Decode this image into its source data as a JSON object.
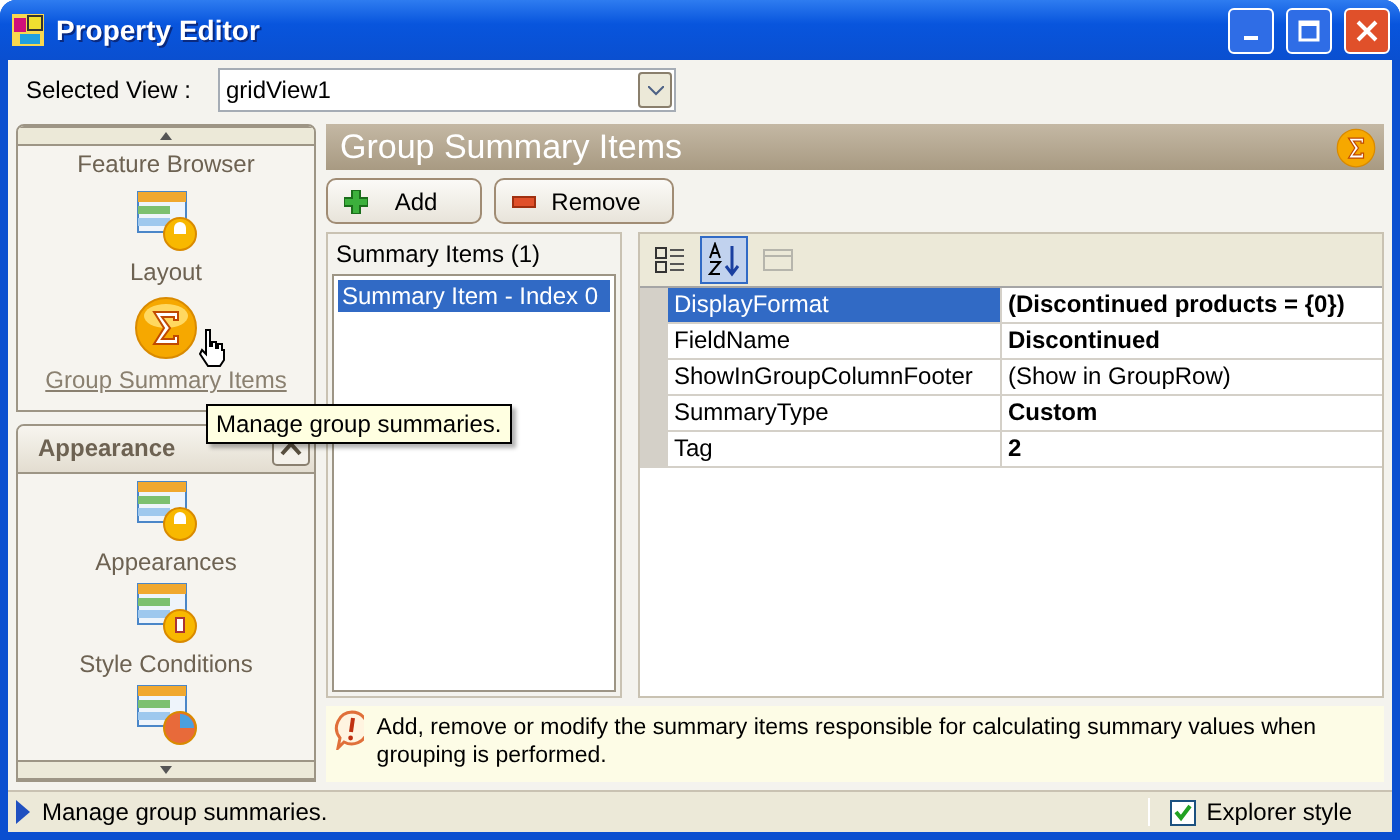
{
  "window": {
    "title": "Property Editor"
  },
  "selected_view": {
    "label": "Selected View :",
    "value": "gridView1"
  },
  "nav_groups": [
    {
      "items": [
        {
          "label": "Feature Browser",
          "kind": "text",
          "hovered": false
        },
        {
          "label": "Layout",
          "kind": "grid",
          "hovered": false
        },
        {
          "label": "Group Summary Items",
          "kind": "sigma",
          "hovered": true
        }
      ]
    },
    {
      "title": "Appearance",
      "expanded": true,
      "items": [
        {
          "label": "Appearances",
          "kind": "grid",
          "hovered": false
        },
        {
          "label": "Style Conditions",
          "kind": "brush",
          "hovered": false
        },
        {
          "kind": "pie"
        }
      ]
    }
  ],
  "tooltip": "Manage group summaries.",
  "panel": {
    "title": "Group Summary Items",
    "buttons": [
      {
        "label": "Add",
        "kind": "add"
      },
      {
        "label": "Remove",
        "kind": "remove"
      }
    ],
    "list": {
      "header": "Summary Items (1)",
      "items": [
        {
          "label": "Summary Item - Index 0",
          "selected": true
        }
      ]
    },
    "toolbar": [
      {
        "kind": "categorized",
        "selected": false,
        "disabled": false
      },
      {
        "kind": "alphabetical",
        "selected": true,
        "disabled": false
      },
      {
        "kind": "pages",
        "selected": false,
        "disabled": true
      }
    ],
    "properties": [
      {
        "name": "DisplayFormat",
        "value": "(Discontinued products = {0})",
        "bold": true,
        "selected": true
      },
      {
        "name": "FieldName",
        "value": "Discontinued",
        "bold": true,
        "selected": false
      },
      {
        "name": "ShowInGroupColumnFooter",
        "value": "(Show in GroupRow)",
        "bold": false,
        "selected": false
      },
      {
        "name": "SummaryType",
        "value": "Custom",
        "bold": true,
        "selected": false
      },
      {
        "name": "Tag",
        "value": "2",
        "bold": true,
        "selected": false
      }
    ],
    "info": "Add, remove or modify the summary items responsible for calculating summary values when grouping is performed."
  },
  "status_bar": {
    "text": "Manage group summaries.",
    "checkbox": {
      "label": "Explorer style",
      "checked": true
    }
  }
}
